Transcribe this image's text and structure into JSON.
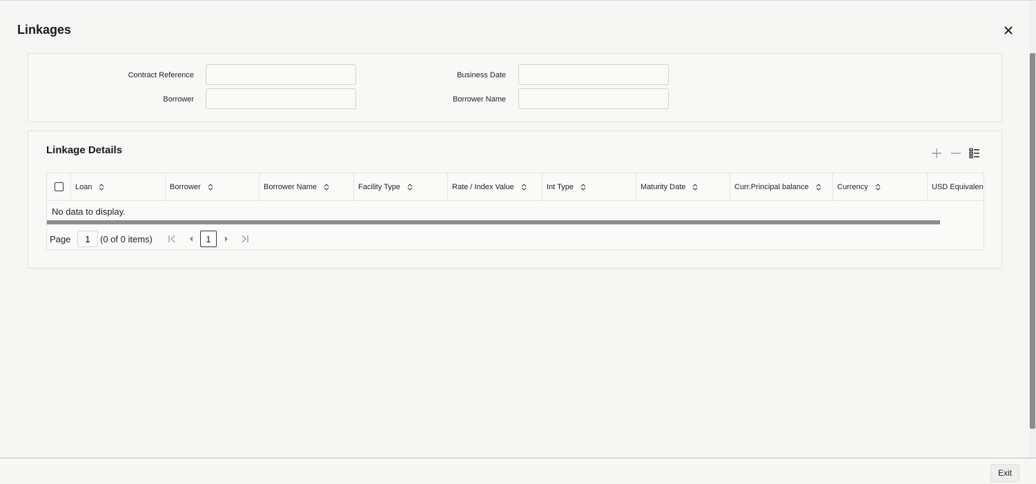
{
  "window": {
    "title": "Linkages",
    "close_icon": "close-icon"
  },
  "form": {
    "contract_reference": {
      "label": "Contract Reference",
      "value": ""
    },
    "business_date": {
      "label": "Business Date",
      "value": ""
    },
    "borrower": {
      "label": "Borrower",
      "value": ""
    },
    "borrower_name": {
      "label": "Borrower Name",
      "value": ""
    }
  },
  "linkage_details": {
    "title": "Linkage Details",
    "toolbar": {
      "add_icon": "plus-icon",
      "remove_icon": "minus-icon",
      "columns_icon": "column-list-icon"
    },
    "columns": [
      "Loan",
      "Borrower",
      "Borrower Name",
      "Facility Type",
      "Rate / Index Value",
      "Int Type",
      "Maturity Date",
      "Curr.Principal balance",
      "Currency",
      "USD Equivalent"
    ],
    "empty_text": "No data to display.",
    "pager": {
      "label": "Page",
      "current_page": "1",
      "items_text": "(0 of 0 items)",
      "page_button": "1"
    }
  },
  "footer": {
    "exit_label": "Exit"
  },
  "colors": {
    "accent": "#161513",
    "scrollbar": "#8d8d8d",
    "background": "#f6f6f5"
  }
}
